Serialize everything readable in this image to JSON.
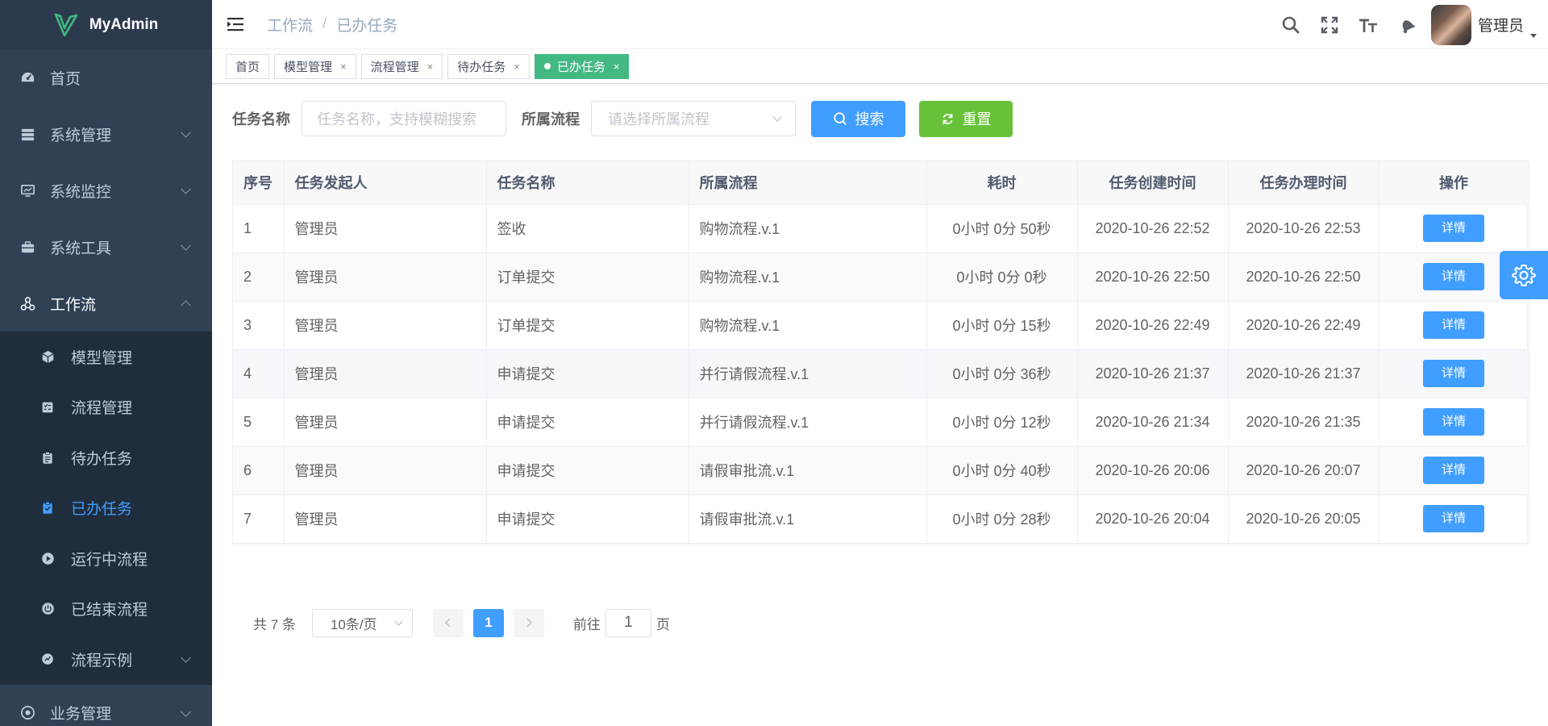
{
  "app": {
    "title": "MyAdmin",
    "accent": "#409eff",
    "sidebar_bg": "#304156",
    "tag_active_bg": "#42b983"
  },
  "sidebar": {
    "items": [
      {
        "label": "首页",
        "icon": "dashboard-icon"
      },
      {
        "label": "系统管理",
        "icon": "system-icon"
      },
      {
        "label": "系统监控",
        "icon": "monitor-icon"
      },
      {
        "label": "系统工具",
        "icon": "tool-icon"
      },
      {
        "label": "工作流",
        "icon": "workflow-icon"
      }
    ],
    "submenu": [
      {
        "label": "模型管理",
        "icon": "cube-icon"
      },
      {
        "label": "流程管理",
        "icon": "list-icon"
      },
      {
        "label": "待办任务",
        "icon": "clipboard-icon"
      },
      {
        "label": "已办任务",
        "icon": "clipboard-check-icon"
      },
      {
        "label": "运行中流程",
        "icon": "play-icon"
      },
      {
        "label": "已结束流程",
        "icon": "power-icon"
      },
      {
        "label": "流程示例",
        "icon": "example-icon"
      }
    ],
    "after": [
      {
        "label": "业务管理",
        "icon": "business-icon"
      }
    ]
  },
  "breadcrumb": {
    "parent": "工作流",
    "separator": "/",
    "current": "已办任务"
  },
  "user": {
    "name": "管理员"
  },
  "tags": [
    {
      "label": "首页",
      "closable": false
    },
    {
      "label": "模型管理",
      "closable": true
    },
    {
      "label": "流程管理",
      "closable": true
    },
    {
      "label": "待办任务",
      "closable": true
    },
    {
      "label": "已办任务",
      "closable": true,
      "active": true
    }
  ],
  "search": {
    "name_label": "任务名称",
    "name_placeholder": "任务名称，支持模糊搜索",
    "flow_label": "所属流程",
    "flow_placeholder": "请选择所属流程",
    "search_btn": "搜索",
    "reset_btn": "重置"
  },
  "table": {
    "headers": [
      "序号",
      "任务发起人",
      "任务名称",
      "所属流程",
      "耗时",
      "任务创建时间",
      "任务办理时间",
      "操作"
    ],
    "rows": [
      [
        "1",
        "管理员",
        "签收",
        "购物流程.v.1",
        "0小时 0分 50秒",
        "2020-10-26 22:52",
        "2020-10-26 22:53",
        "详情"
      ],
      [
        "2",
        "管理员",
        "订单提交",
        "购物流程.v.1",
        "0小时 0分 0秒",
        "2020-10-26 22:50",
        "2020-10-26 22:50",
        "详情"
      ],
      [
        "3",
        "管理员",
        "订单提交",
        "购物流程.v.1",
        "0小时 0分 15秒",
        "2020-10-26 22:49",
        "2020-10-26 22:49",
        "详情"
      ],
      [
        "4",
        "管理员",
        "申请提交",
        "并行请假流程.v.1",
        "0小时 0分 36秒",
        "2020-10-26 21:37",
        "2020-10-26 21:37",
        "详情"
      ],
      [
        "5",
        "管理员",
        "申请提交",
        "并行请假流程.v.1",
        "0小时 0分 12秒",
        "2020-10-26 21:34",
        "2020-10-26 21:35",
        "详情"
      ],
      [
        "6",
        "管理员",
        "申请提交",
        "请假审批流.v.1",
        "0小时 0分 40秒",
        "2020-10-26 20:06",
        "2020-10-26 20:07",
        "详情"
      ],
      [
        "7",
        "管理员",
        "申请提交",
        "请假审批流.v.1",
        "0小时 0分 28秒",
        "2020-10-26 20:04",
        "2020-10-26 20:05",
        "详情"
      ]
    ]
  },
  "pagination": {
    "total_text": "共 7 条",
    "page_size": "10条/页",
    "current_page": "1",
    "goto_prefix": "前往",
    "goto_value": "1",
    "goto_suffix": "页"
  }
}
